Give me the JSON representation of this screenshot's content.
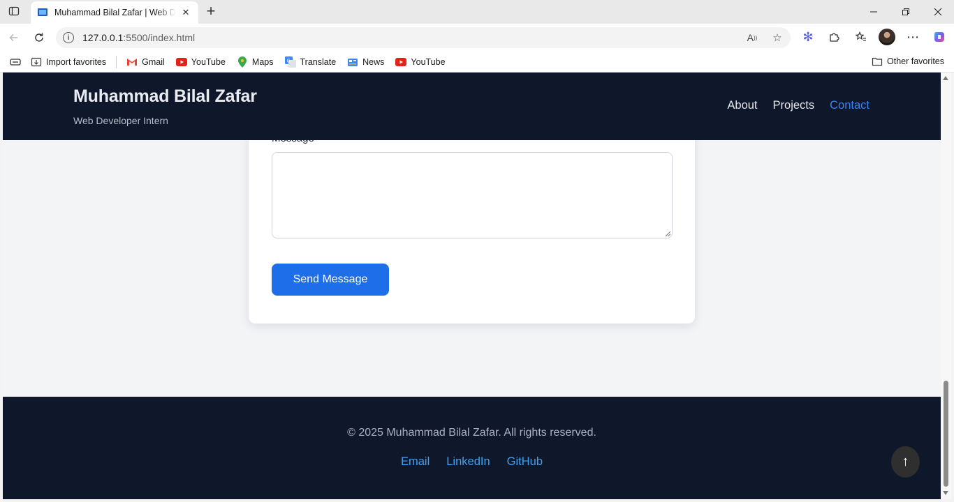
{
  "browser": {
    "tab_title": "Muhammad Bilal Zafar | Web Developer Intern",
    "url_host": "127.0.0.1",
    "url_rest": ":5500/index.html",
    "favorites": [
      {
        "label": "Import favorites",
        "icon": "import-icon"
      },
      {
        "label": "Gmail",
        "icon": "gmail-icon"
      },
      {
        "label": "YouTube",
        "icon": "youtube-icon"
      },
      {
        "label": "Maps",
        "icon": "maps-icon"
      },
      {
        "label": "Translate",
        "icon": "translate-icon"
      },
      {
        "label": "News",
        "icon": "news-icon"
      },
      {
        "label": "YouTube",
        "icon": "youtube-icon"
      }
    ],
    "other_favorites": "Other favorites"
  },
  "site": {
    "name": "Muhammad Bilal Zafar",
    "role": "Web Developer Intern",
    "nav": [
      {
        "label": "About",
        "active": false
      },
      {
        "label": "Projects",
        "active": false
      },
      {
        "label": "Contact",
        "active": true
      }
    ]
  },
  "contact": {
    "message_label": "Message",
    "message_value": "",
    "send_label": "Send Message"
  },
  "footer": {
    "copyright": "© 2025 Muhammad Bilal Zafar. All rights reserved.",
    "links": [
      "Email",
      "LinkedIn",
      "GitHub"
    ],
    "back_to_top": "↑"
  },
  "colors": {
    "header_bg": "#0f172a",
    "accent": "#1d6ee8",
    "nav_active": "#3b82f6",
    "footer_link": "#3ea2f0"
  }
}
